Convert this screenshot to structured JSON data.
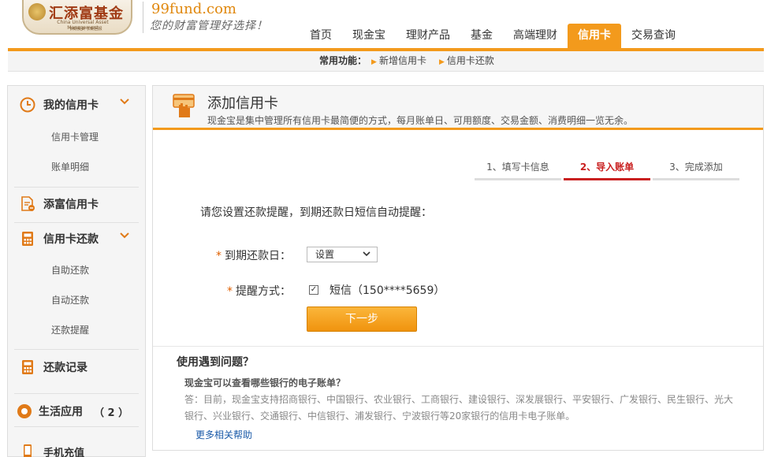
{
  "brand": {
    "logo_cn": "汇添富基金",
    "logo_en": "China Universal Asset Management",
    "logo_sub": "长期投资 长期回报",
    "site": "99fund.com",
    "slogan": "您的财富管理好选择！"
  },
  "nav": {
    "items": [
      "首页",
      "现金宝",
      "理财产品",
      "基金",
      "高端理财",
      "信用卡",
      "交易查询"
    ],
    "active": "信用卡"
  },
  "sub_bar": {
    "label": "常用功能：",
    "links": [
      "新增信用卡",
      "信用卡还款"
    ]
  },
  "sidebar": {
    "my_cards": "我的信用卡",
    "card_manage": "信用卡管理",
    "bill_detail": "账单明细",
    "add_card": "添富信用卡",
    "repay": "信用卡还款",
    "self_repay": "自助还款",
    "auto_repay": "自动还款",
    "repay_remind": "还款提醒",
    "repay_record": "还款记录",
    "life_app": "生活应用",
    "life_count": "（ 2 ）",
    "phone_topup": "手机充值"
  },
  "main": {
    "title": "添加信用卡",
    "description": "现金宝是集中管理所有信用卡最简便的方式，每月账单日、可用额度、交易金额、消费明细一览无余。",
    "steps": [
      "1、填写卡信息",
      "2、导入账单",
      "3、完成添加"
    ],
    "active_step": 1,
    "prompt": "请您设置还款提醒，到期还款日短信自动提醒：",
    "due_label": "到期还款日：",
    "due_select": "设置",
    "remind_label": "提醒方式：",
    "sms_label": "短信（150****5659）",
    "sms_checked": true,
    "next_button": "下一步",
    "required_mark": "*"
  },
  "help": {
    "title": "使用遇到问题？",
    "question": "现金宝可以查看哪些银行的电子账单？",
    "answer": "答：目前，现金宝支持招商银行、中国银行、农业银行、工商银行、建设银行、深发展银行、平安银行、广发银行、民生银行、光大银行、兴业银行、交通银行、中信银行、浦发银行、宁波银行等20家银行的信用卡电子账单。",
    "more_link": "更多相关帮助"
  },
  "colors": {
    "accent": "#f39a1c",
    "step_active": "#c92020",
    "link": "#1a5aa8"
  }
}
